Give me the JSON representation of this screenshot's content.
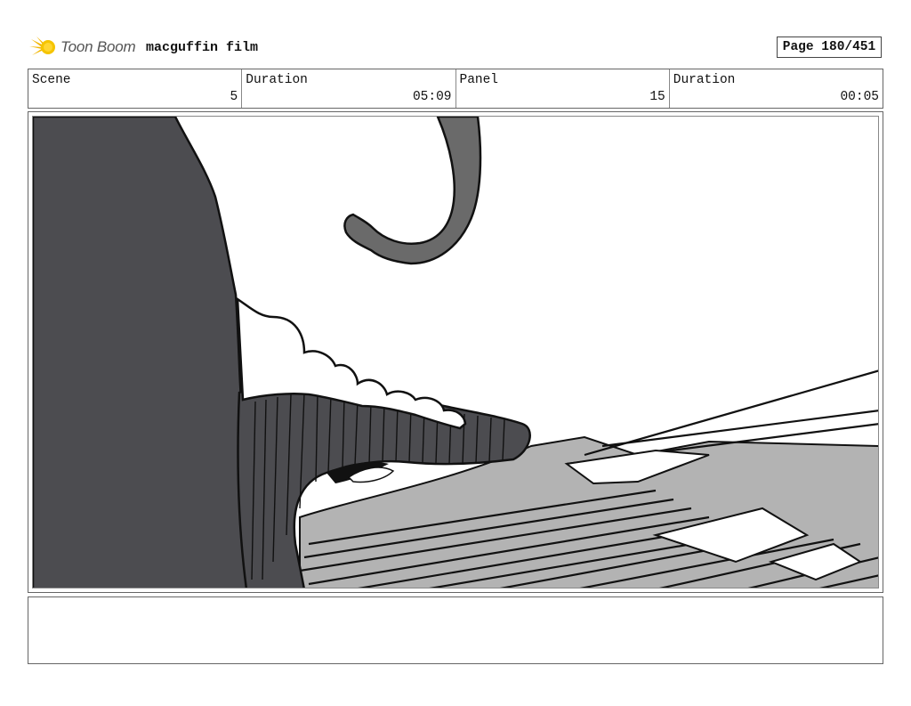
{
  "header": {
    "brand": "Toon Boom",
    "brand_icon": "toon-boom-star-logo",
    "project_title": "macguffin film",
    "page_label": "Page 180/451"
  },
  "info": {
    "scene_label": "Scene",
    "scene_value": "5",
    "scene_duration_label": "Duration",
    "scene_duration_value": "05:09",
    "panel_label": "Panel",
    "panel_value": "15",
    "panel_duration_label": "Duration",
    "panel_duration_value": "00:05"
  },
  "panel": {
    "description": "",
    "colors": {
      "dark_gray": "#4c4c50",
      "mid_gray": "#6a6a6a",
      "light_gray": "#b3b3b3",
      "line": "#111111"
    }
  },
  "notes": {
    "text": ""
  }
}
